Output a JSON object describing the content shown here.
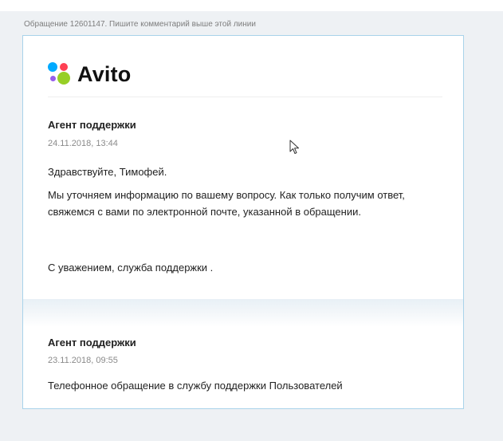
{
  "ticket_note": "Обращение 12601147. Пишите комментарий выше этой линии",
  "logo": {
    "text": "Avito",
    "dot_colors": [
      "#00aaff",
      "#ff4053",
      "#965eeb",
      "#97cf26"
    ]
  },
  "messages": [
    {
      "author": "Агент поддержки",
      "date": "24.11.2018, 13:44",
      "greeting": "Здравствуйте, Тимофей.",
      "body": "Мы уточняем информацию по вашему вопросу. Как только получим ответ, свяжемся с вами по электронной почте, указанной в обращении.",
      "signature": "С уважением, служба поддержки ."
    },
    {
      "author": "Агент поддержки",
      "date": "23.11.2018, 09:55",
      "body": "Телефонное обращение в службу поддержки Пользователей"
    }
  ],
  "colors": {
    "page_background": "#eef1f4",
    "card_border": "#a9d3ea"
  }
}
